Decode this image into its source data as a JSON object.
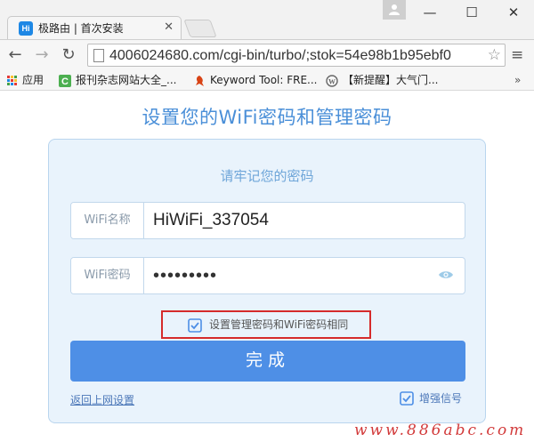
{
  "browser": {
    "tab": {
      "favicon_text": "Hi",
      "title": "极路由 | 首次安装"
    },
    "address": {
      "url": "4006024680.com/cgi-bin/turbo/;stok=54e98b1b95ebf0"
    },
    "bookmarks": [
      {
        "label": "应用",
        "icon": "apps-grid-icon"
      },
      {
        "label": "报刊杂志网站大全_...",
        "icon": "green-c-icon"
      },
      {
        "label": "Keyword Tool: FRE...",
        "icon": "red-bird-icon"
      },
      {
        "label": "【新提醒】大气门...",
        "icon": "wordpress-icon"
      }
    ],
    "bookmarks_more": "»",
    "window_controls": {
      "minimize": "—",
      "maximize": "☐",
      "close": "✕"
    }
  },
  "page": {
    "heading": "设置您的WiFi密码和管理密码",
    "subtitle": "请牢记您的密码",
    "wifi_name": {
      "label": "WiFi名称",
      "value": "HiWiFi_337054"
    },
    "wifi_password": {
      "label": "WiFi密码",
      "masked_value": "•••••••••"
    },
    "same_password": {
      "label": "设置管理密码和WiFi密码相同",
      "checked": true
    },
    "done_button": "完成",
    "back_link": "返回上网设置",
    "boost_signal": {
      "label": "增强信号",
      "checked": true
    }
  },
  "watermark": "www.886abc.com",
  "colors": {
    "accent": "#4e8fe6",
    "heading": "#4a8fd8",
    "card_bg": "#e9f3fc",
    "highlight_box": "#d52b2b"
  }
}
